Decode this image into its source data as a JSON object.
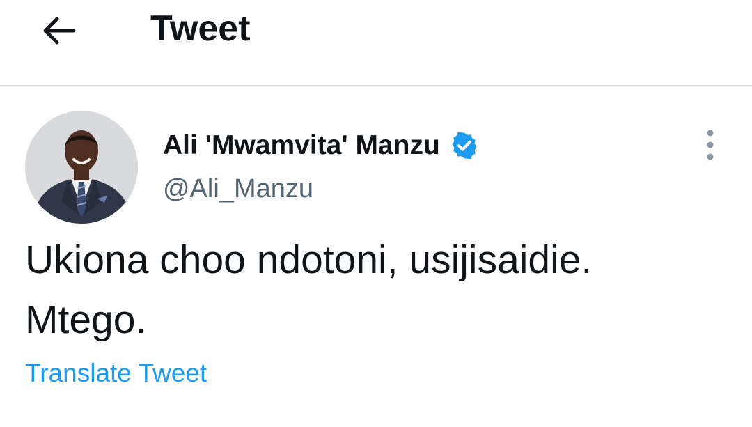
{
  "header": {
    "title": "Tweet",
    "back_icon": "arrow-left-icon"
  },
  "tweet": {
    "author": {
      "name": "Ali 'Mwamvita' Manzu",
      "handle": "@Ali_Manzu",
      "verified": true,
      "verified_icon": "verified-badge-icon",
      "avatar_icon": "profile-photo"
    },
    "text_lines": [
      "Ukiona choo ndotoni, usijisaidie.",
      "Mtego."
    ],
    "more_icon": "more-vertical-icon",
    "translate_label": "Translate Tweet"
  },
  "colors": {
    "text_primary": "#0f1419",
    "text_secondary": "#536471",
    "accent": "#1d9bf0",
    "divider": "#e1e5e8"
  }
}
